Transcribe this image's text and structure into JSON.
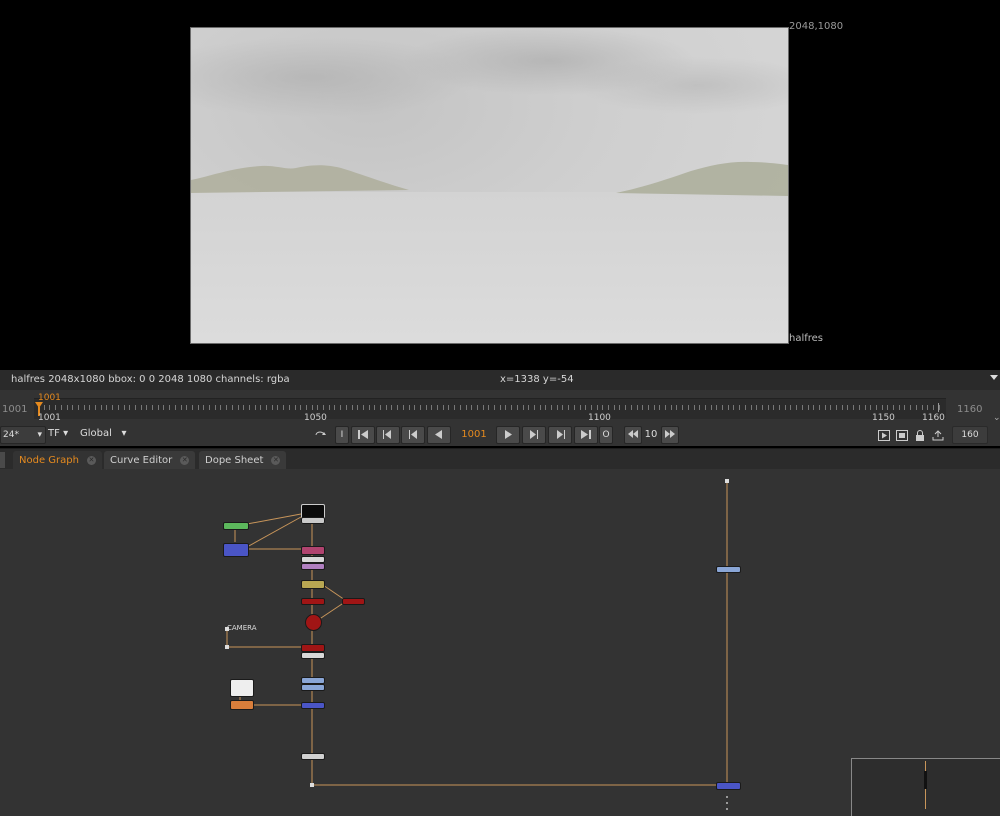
{
  "viewer": {
    "format_label_top": "2048,1080",
    "format_label_bottom": "halfres"
  },
  "infobar": {
    "image_info": "halfres 2048x1080  bbox: 0 0 2048 1080 channels: rgba",
    "cursor_info": "x=1338 y=-54"
  },
  "timeline": {
    "in_frame": "1001",
    "out_frame": "1160",
    "playhead_label": "1001",
    "tick_labels": [
      "1001",
      "1050",
      "1100",
      "1150",
      "1160"
    ],
    "fps": "24*",
    "tf_label": "TF",
    "range_mode": "Global",
    "current_frame": "1001",
    "step_value": "10",
    "end_frame_field": "160"
  },
  "tabs": [
    {
      "label": "Node Graph",
      "active": true
    },
    {
      "label": "Curve Editor",
      "active": false
    },
    {
      "label": "Dope Sheet",
      "active": false
    }
  ],
  "nodegraph": {
    "camera_label": "CAMERA"
  },
  "colors": {
    "accent": "#e58a1f",
    "wire": "#c8955a"
  }
}
